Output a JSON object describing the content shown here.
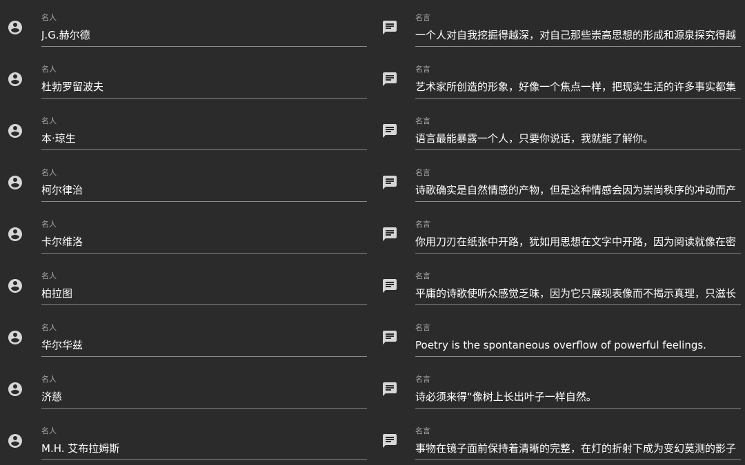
{
  "colors": {
    "background": "#2b2b2b",
    "label": "#a8a8a8",
    "text": "#ffffff",
    "underline": "#8a8a8a",
    "icon": "#d6d6d6"
  },
  "icons": {
    "person": "account-circle-icon",
    "quote": "comment-icon"
  },
  "rows": [
    {
      "name_label": "名人",
      "name": "J.G.赫尔德",
      "quote_label": "名言",
      "quote": "一个人对自我挖掘得越深，对自己那些崇高思想的形成和源泉探究得越"
    },
    {
      "name_label": "名人",
      "name": "杜勃罗留波夫",
      "quote_label": "名言",
      "quote": "艺术家所创造的形象，好像一个焦点一样，把现实生活的许多事实都集"
    },
    {
      "name_label": "名人",
      "name": "本·琼生",
      "quote_label": "名言",
      "quote": "语言最能暴露一个人，只要你说话，我就能了解你。"
    },
    {
      "name_label": "名人",
      "name": "柯尔律治",
      "quote_label": "名言",
      "quote": "诗歌确实是自然情感的产物，但是这种情感会因为崇尚秩序的冲动而产"
    },
    {
      "name_label": "名人",
      "name": "卡尔维洛",
      "quote_label": "名言",
      "quote": "你用刀刃在纸张中开路，犹如用思想在文字中开路，因为阅读就像在密"
    },
    {
      "name_label": "名人",
      "name": "柏拉图",
      "quote_label": "名言",
      "quote": "平庸的诗歌使听众感觉乏味，因为它只展现表像而不揭示真理，只滋长"
    },
    {
      "name_label": "名人",
      "name": "华尔华兹",
      "quote_label": "名言",
      "quote": "Poetry is the spontaneous overflow of powerful feelings."
    },
    {
      "name_label": "名人",
      "name": "济慈",
      "quote_label": "名言",
      "quote": "诗必须来得“像树上长出叶子一样自然。"
    },
    {
      "name_label": "名人",
      "name": "M.H. 艾布拉姆斯",
      "quote_label": "名言",
      "quote": "事物在镜子面前保持着清晰的完整，在灯的折射下成为变幻莫测的影子"
    }
  ]
}
